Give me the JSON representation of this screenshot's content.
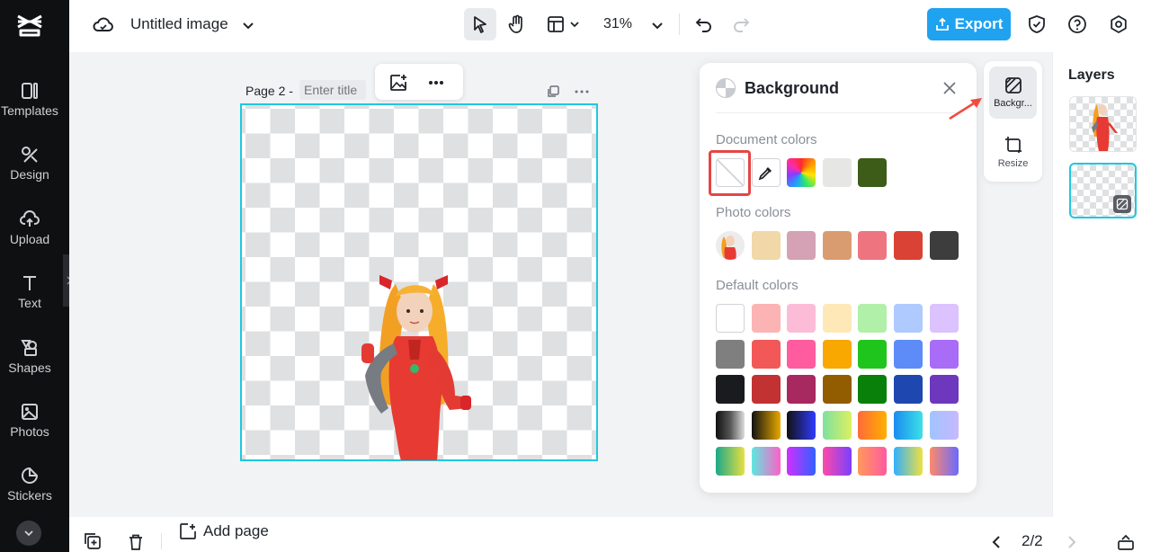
{
  "app": {
    "logo_icon": "capcut-logo-icon"
  },
  "sidebar": {
    "items": [
      {
        "label": "Templates",
        "icon": "templates-icon"
      },
      {
        "label": "Design",
        "icon": "design-icon"
      },
      {
        "label": "Upload",
        "icon": "upload-cloud-icon"
      },
      {
        "label": "Text",
        "icon": "text-icon"
      },
      {
        "label": "Shapes",
        "icon": "shapes-icon"
      },
      {
        "label": "Photos",
        "icon": "photos-icon"
      },
      {
        "label": "Stickers",
        "icon": "stickers-icon"
      }
    ]
  },
  "header": {
    "title": "Untitled image",
    "zoom": "31%",
    "export_label": "Export"
  },
  "canvas": {
    "page_label": "Page 2 -",
    "title_placeholder": "Enter title"
  },
  "background_panel": {
    "title": "Background",
    "document_colors_label": "Document colors",
    "photo_colors_label": "Photo colors",
    "default_colors_label": "Default colors",
    "document_colors": [
      "transparent",
      "eyedropper",
      "rainbow",
      "#e6e6e4",
      "#3d5c17"
    ],
    "photo_colors": [
      "#f0d8a8",
      "#d4a2b4",
      "#d99c70",
      "#ee7580",
      "#d94234",
      "#3d3d3d"
    ],
    "default_colors": [
      [
        "#ffffff",
        "#fcb3b3",
        "#fcbcd8",
        "#ffe8b8",
        "#b0f0a8",
        "#aecaff",
        "#dcc2ff"
      ],
      [
        "#7f7f7f",
        "#f25858",
        "#ff5ca0",
        "#f8a800",
        "#1fc51c",
        "#5d8cf8",
        "#a86cf6"
      ],
      [
        "#1a1b1f",
        "#c23232",
        "#a82860",
        "#925c00",
        "#08800a",
        "#1e48b0",
        "#6e38be"
      ],
      [
        "#2c2c2c-grad",
        "#000-gold-grad",
        "#000-blue-grad",
        "#8ce-lime-grad",
        "#f84-orange-grad",
        "#1ac-blue-grad",
        "#ace-lavender-grad"
      ],
      [
        "#2a8-yellow-grad",
        "#8ef-pink-grad",
        "#c3f-blue-grad",
        "#f4a-purple-grad",
        "#fa6-pink-grad",
        "#3bf-yellow-grad",
        "#f87-blue-grad"
      ]
    ]
  },
  "side_tools": {
    "background_label": "Backgr...",
    "resize_label": "Resize"
  },
  "layers": {
    "title": "Layers"
  },
  "footer": {
    "add_page_label": "Add page",
    "page_count": "2/2"
  }
}
